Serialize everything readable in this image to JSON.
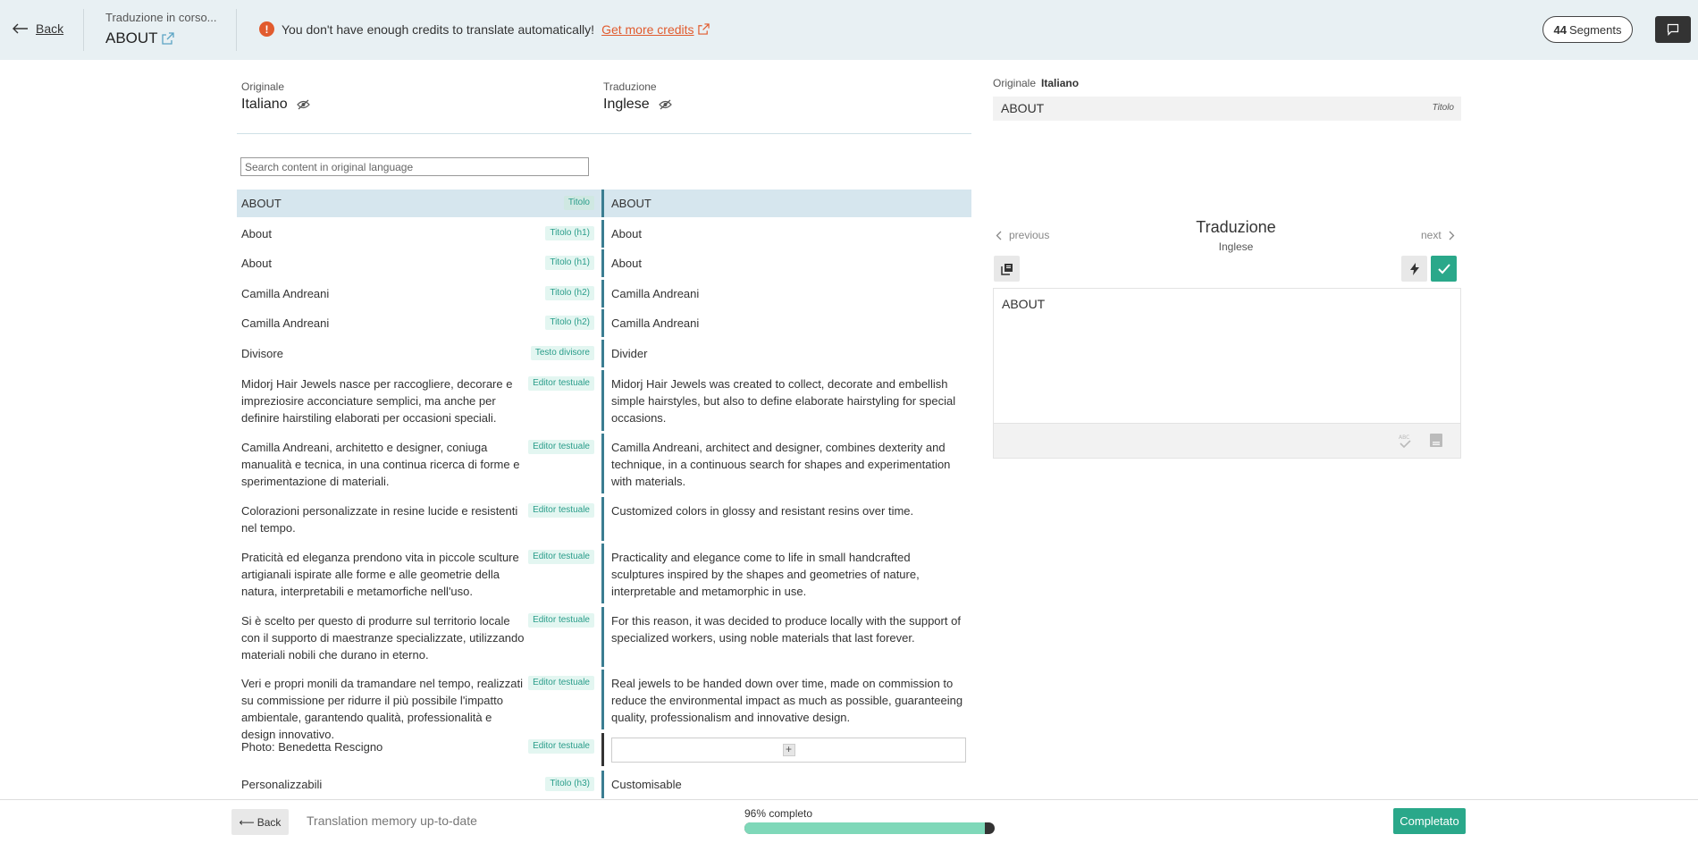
{
  "header": {
    "back_label": "Back",
    "subtitle": "Traduzione in corso...",
    "title": "ABOUT",
    "warning_text": "You don't have enough credits to translate automatically!",
    "warning_link": "Get more credits",
    "segments_count": "44",
    "segments_label": "Segments"
  },
  "columns": {
    "original_label": "Originale",
    "original_lang": "Italiano",
    "translation_label": "Traduzione",
    "translation_lang": "Inglese"
  },
  "search": {
    "placeholder": "Search content in original language"
  },
  "rows": [
    {
      "src": "ABOUT",
      "tag": "Titolo",
      "tgt": "ABOUT"
    },
    {
      "src": "About",
      "tag": "Titolo (h1)",
      "tgt": "About"
    },
    {
      "src": "About",
      "tag": "Titolo (h1)",
      "tgt": "About"
    },
    {
      "src": "Camilla Andreani",
      "tag": "Titolo (h2)",
      "tgt": "Camilla Andreani"
    },
    {
      "src": "Camilla Andreani",
      "tag": "Titolo (h2)",
      "tgt": "Camilla Andreani"
    },
    {
      "src": "Divisore",
      "tag": "Testo divisore",
      "tgt": "Divider"
    },
    {
      "src": "Midorj Hair Jewels nasce per raccogliere, decorare e impreziosire acconciature semplici, ma anche per definire hairstiling elaborati per occasioni speciali.",
      "tag": "Editor testuale",
      "tgt": "Midorj Hair Jewels was created to collect, decorate and embellish simple hairstyles, but also to define elaborate hairstyling for special occasions."
    },
    {
      "src": "Camilla Andreani, architetto e designer, coniuga manualità e tecnica, in una continua ricerca di forme e sperimentazione di materiali.",
      "tag": "Editor testuale",
      "tgt": "Camilla Andreani, architect and designer, combines dexterity and technique, in a continuous search for shapes and experimentation with materials."
    },
    {
      "src": "Colorazioni personalizzate in resine lucide e resistenti nel tempo.",
      "tag": "Editor testuale",
      "tgt": "Customized colors in glossy and resistant resins over time."
    },
    {
      "src": "Praticità ed eleganza prendono vita in piccole sculture artigianali ispirate alle forme e alle geometrie della natura, interpretabili e metamorfiche nell'uso.",
      "tag": "Editor testuale",
      "tgt": "Practicality and elegance come to life in small handcrafted sculptures inspired by the shapes and geometries of nature, interpretable and metamorphic in use."
    },
    {
      "src": "Si è scelto per questo di produrre sul territorio locale con il supporto di maestranze specializzate, utilizzando materiali nobili che durano in eterno.",
      "tag": "Editor testuale",
      "tgt": "For this reason, it was decided to produce locally with the support of specialized workers, using noble materials that last forever."
    },
    {
      "src": "Veri e propri monili da tramandare nel tempo, realizzati su commissione per ridurre il più possibile l'impatto ambientale, garantendo qualità, professionalità e design innovativo.",
      "tag": "Editor testuale",
      "tgt": "Real jewels to be handed down over time, made on commission to reduce the environmental impact as much as possible, guaranteeing quality, professionalism and innovative design."
    },
    {
      "src": "Photo: Benedetta Rescigno",
      "tag": "Editor testuale",
      "tgt": ""
    },
    {
      "src": "Personalizzabili",
      "tag": "Titolo (h3)",
      "tgt": "Customisable"
    }
  ],
  "right_panel": {
    "original_label": "Originale",
    "original_lang": "Italiano",
    "original_text": "ABOUT",
    "original_tag": "Titolo",
    "prev_label": "previous",
    "next_label": "next",
    "title": "Traduzione",
    "subtitle": "Inglese",
    "editor_text": "ABOUT"
  },
  "footer": {
    "back_label": "Back",
    "status": "Translation memory up-to-date",
    "progress_label": "96% completo",
    "progress_percent": 96,
    "done_label": "Completato"
  },
  "colors": {
    "accent": "#2aa88a",
    "warning": "#e15b2e",
    "active_row": "#d6e6ee",
    "tag_bg": "#e3f6f1",
    "progress_fill": "#7fd8b9"
  }
}
